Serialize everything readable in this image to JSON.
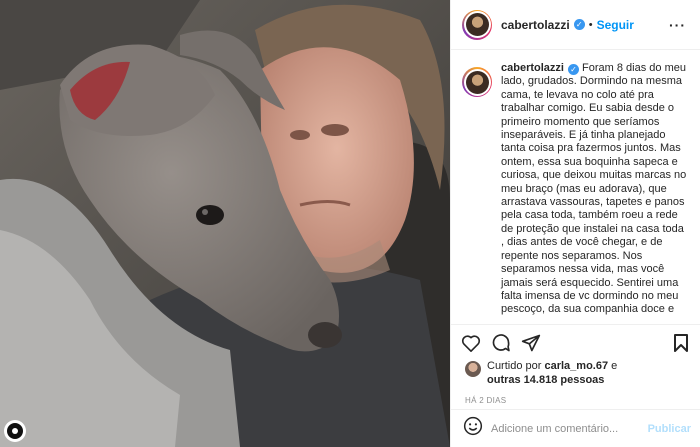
{
  "post": {
    "username": "cabertolazzi",
    "follow_label": "Seguir",
    "caption": "Foram 8 dias do meu lado, grudados. Dormindo na mesma cama, te levava no colo até pra trabalhar comigo. Eu sabia desde o primeiro momento que seríamos inseparáveis. E já tinha planejado tanta coisa pra fazermos juntos. Mas ontem, essa sua boquinha sapeca e curiosa, que deixou muitas marcas no meu braço (mas eu adorava), que arrastava vassouras, tapetes e panos pela casa toda, também roeu a rede de proteção que instalei na casa toda , dias antes de você chegar, e de repente nos separamos. Nos separamos nessa vida, mas você jamais será esquecido. Sentirei uma falta imensa de vc dormindo no meu pescoço, da sua companhia doce e",
    "liked_prefix": "Curtido por",
    "liked_user": "carla_mo.67",
    "liked_and": "e",
    "liked_others": "outras 14.818 pessoas",
    "timestamp": "HÁ 2 DIAS",
    "comment_placeholder": "Adicione um comentário...",
    "publish_label": "Publicar"
  },
  "icons": {
    "verified": "verified-check-icon",
    "more": "more-options-icon",
    "like": "heart-icon",
    "comment": "comment-icon",
    "share": "share-icon",
    "save": "bookmark-icon",
    "emoji": "emoji-icon"
  },
  "colors": {
    "accent": "#0095f6",
    "verified": "#3897f0",
    "muted": "#8e8e8e",
    "publish_disabled": "#b2dffc"
  }
}
